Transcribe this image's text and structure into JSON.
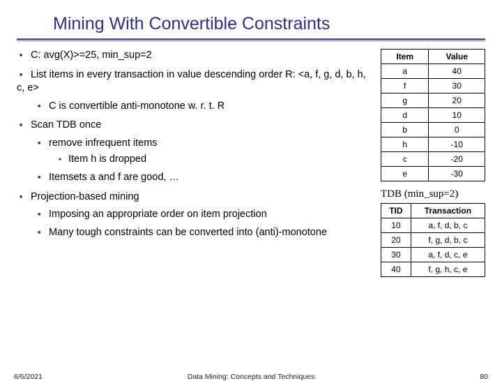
{
  "title": "Mining With Convertible Constraints",
  "bullets": {
    "b1": "C: avg(X)>=25, min_sup=2",
    "b2": "List items in every transaction in value descending order R: <a, f, g, d, b, h, c, e>",
    "b2_1": "C is convertible anti-monotone w. r. t. R",
    "b3": "Scan TDB once",
    "b3_1": "remove infrequent items",
    "b3_1_1": "Item h is dropped",
    "b3_2": "Itemsets a and f are good, …",
    "b4": "Projection-based mining",
    "b4_1": "Imposing an appropriate order on item projection",
    "b4_2": "Many tough constraints can be converted into (anti)-monotone"
  },
  "table1": {
    "headers": {
      "c1": "Item",
      "c2": "Value"
    },
    "rows": [
      {
        "item": "a",
        "value": "40"
      },
      {
        "item": "f",
        "value": "30"
      },
      {
        "item": "g",
        "value": "20"
      },
      {
        "item": "d",
        "value": "10"
      },
      {
        "item": "b",
        "value": "0"
      },
      {
        "item": "h",
        "value": "-10"
      },
      {
        "item": "c",
        "value": "-20"
      },
      {
        "item": "e",
        "value": "-30"
      }
    ]
  },
  "tdb_caption": "TDB (min_sup=2)",
  "table2": {
    "headers": {
      "c1": "TID",
      "c2": "Transaction"
    },
    "rows": [
      {
        "tid": "10",
        "txn": "a, f, d, b, c"
      },
      {
        "tid": "20",
        "txn": "f, g, d, b, c"
      },
      {
        "tid": "30",
        "txn": "a, f, d, c, e"
      },
      {
        "tid": "40",
        "txn": "f, g, h, c, e"
      }
    ]
  },
  "footer": {
    "date": "6/6/2021",
    "center": "Data Mining: Concepts and Techniques",
    "page": "80"
  },
  "chart_data": [
    {
      "type": "table",
      "title": "Item-Value table",
      "headers": [
        "Item",
        "Value"
      ],
      "rows": [
        [
          "a",
          40
        ],
        [
          "f",
          30
        ],
        [
          "g",
          20
        ],
        [
          "d",
          10
        ],
        [
          "b",
          0
        ],
        [
          "h",
          -10
        ],
        [
          "c",
          -20
        ],
        [
          "e",
          -30
        ]
      ]
    },
    {
      "type": "table",
      "title": "TDB (min_sup=2)",
      "headers": [
        "TID",
        "Transaction"
      ],
      "rows": [
        [
          10,
          "a, f, d, b, c"
        ],
        [
          20,
          "f, g, d, b, c"
        ],
        [
          30,
          "a, f, d, c, e"
        ],
        [
          40,
          "f, g, h, c, e"
        ]
      ]
    }
  ]
}
